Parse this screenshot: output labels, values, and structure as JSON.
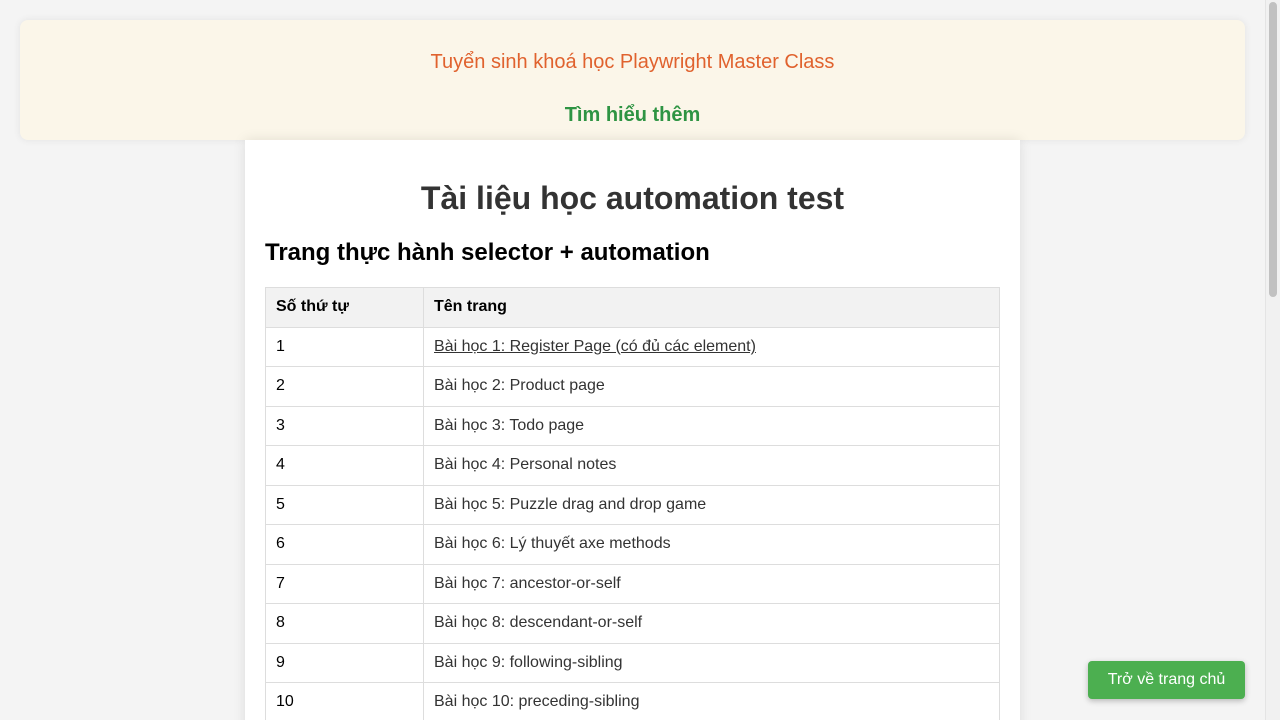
{
  "banner": {
    "title": "Tuyển sinh khoá học Playwright Master Class",
    "link_label": "Tìm hiểu thêm",
    "background_color": "#fbf6e9",
    "title_color": "#e0622e",
    "link_color": "#2e9443"
  },
  "main": {
    "title": "Tài liệu học automation test",
    "section_title": "Trang thực hành selector + automation",
    "table": {
      "headers": [
        "Số thứ tự",
        "Tên trang"
      ],
      "rows": [
        {
          "index": "1",
          "name": "Bài học 1: Register Page (có đủ các element)",
          "is_link": true
        },
        {
          "index": "2",
          "name": "Bài học 2: Product page",
          "is_link": false
        },
        {
          "index": "3",
          "name": "Bài học 3: Todo page",
          "is_link": false
        },
        {
          "index": "4",
          "name": "Bài học 4: Personal notes",
          "is_link": false
        },
        {
          "index": "5",
          "name": "Bài học 5: Puzzle drag and drop game",
          "is_link": false
        },
        {
          "index": "6",
          "name": "Bài học 6: Lý thuyết axe methods",
          "is_link": false
        },
        {
          "index": "7",
          "name": "Bài học 7: ancestor-or-self",
          "is_link": false
        },
        {
          "index": "8",
          "name": "Bài học 8: descendant-or-self",
          "is_link": false
        },
        {
          "index": "9",
          "name": "Bài học 9: following-sibling",
          "is_link": false
        },
        {
          "index": "10",
          "name": "Bài học 10: preceding-sibling",
          "is_link": false
        }
      ]
    }
  },
  "home_button": {
    "label": "Trở về trang chủ",
    "color": "#4caf50"
  }
}
